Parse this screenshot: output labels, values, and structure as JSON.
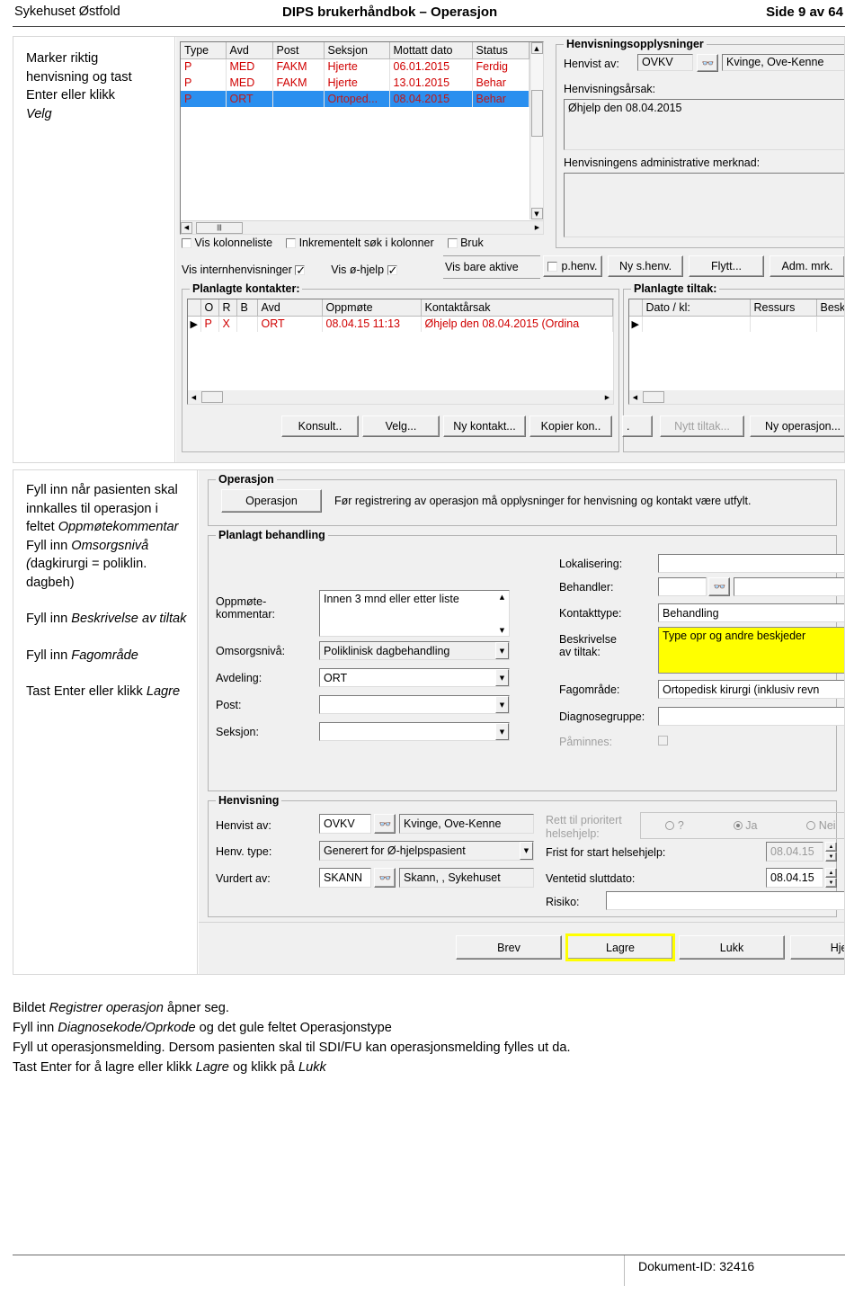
{
  "header": {
    "left": "Sykehuset Østfold",
    "center": "DIPS brukerhåndbok – Operasjon",
    "right": "Side 9 av 64"
  },
  "footer": {
    "document_id": "Dokument-ID: 32416"
  },
  "figure1": {
    "instructions": {
      "line1": "Marker riktig",
      "line2": "henvisning og tast",
      "line3": "Enter eller klikk",
      "line4_italic": "Velg"
    },
    "referral_list": {
      "columns": [
        "Type",
        "Avd",
        "Post",
        "Seksjon",
        "Mottatt dato",
        "Status"
      ],
      "rows": [
        {
          "type": "P",
          "avd": "MED",
          "post": "FAKM",
          "seksjon": "Hjerte",
          "mottatt": "06.01.2015",
          "status": "Ferdig",
          "selected": false
        },
        {
          "type": "P",
          "avd": "MED",
          "post": "FAKM",
          "seksjon": "Hjerte",
          "mottatt": "13.01.2015",
          "status": "Behar",
          "selected": false
        },
        {
          "type": "P",
          "avd": "ORT",
          "post": "",
          "seksjon": "Ortoped...",
          "mottatt": "08.04.2015",
          "status": "Behar",
          "selected": true
        }
      ]
    },
    "list_options": [
      {
        "label": "Vis kolonneliste",
        "checked": false
      },
      {
        "label": "Inkrementelt søk i kolonner",
        "checked": false
      },
      {
        "label": "Bruk",
        "checked": false
      }
    ],
    "filter_row": [
      {
        "label": "Vis internhenvisninger",
        "checked": true
      },
      {
        "label": "Vis ø-hjelp",
        "checked": true
      },
      {
        "label": "Vis bare aktive",
        "checked": false,
        "no_box": true
      },
      {
        "label": "p.henv.",
        "checked": false
      }
    ],
    "referral_buttons": [
      "Ny s.henv.",
      "Flytt...",
      "Adm. mrk."
    ],
    "referral_info": {
      "title": "Henvisningsopplysninger",
      "referred_by_label": "Henvist av:",
      "referred_by_code": "OVKV",
      "referred_by_name": "Kvinge, Ove-Kenne",
      "reason_label": "Henvisningsårsak:",
      "reason_value": "Øhjelp den 08.04.2015",
      "admin_note_label": "Henvisningens administrative merknad:",
      "admin_note_value": ""
    },
    "planned_contacts": {
      "title": "Planlagte kontakter:",
      "columns": [
        "",
        "O",
        "R",
        "B",
        "Avd",
        "Oppmøte",
        "Kontaktårsak"
      ],
      "rows": [
        {
          "o": "P",
          "r": "X",
          "b": "",
          "avd": "ORT",
          "oppmote": "08.04.15 11:13",
          "arsak": "Øhjelp den 08.04.2015 (Ordina"
        }
      ],
      "buttons": [
        "Konsult..",
        "Velg...",
        "Ny kontakt...",
        "Kopier kon.."
      ]
    },
    "planned_measures": {
      "title": "Planlagte tiltak:",
      "columns": [
        "",
        "Dato / kl:",
        "Ressurs",
        "Beskriv"
      ],
      "rows": [
        {
          "dato": "",
          "ressurs": "",
          "beskrivelse": ""
        }
      ],
      "buttons": [
        {
          "label": ".",
          "disabled": false
        },
        {
          "label": "Nytt tiltak...",
          "disabled": true
        },
        {
          "label": "Ny operasjon...",
          "disabled": false
        }
      ]
    }
  },
  "figure2": {
    "instructions": {
      "p1_a": "Fyll inn når pasienten skal innkalles til operasjon i feltet ",
      "p1_b_italic": "Oppmøtekommentar",
      "p2_a": "Fyll inn ",
      "p2_b_italic": "Omsorgsnivå (",
      "p2_c": "dagkirurgi = poliklin. dagbeh)",
      "p3_a": "Fyll inn ",
      "p3_b_italic": "Beskrivelse av tiltak",
      "p4_a": "Fyll inn ",
      "p4_b_italic": "Fagområde",
      "p5_a": "Tast Enter eller klikk ",
      "p5_b_italic": "Lagre"
    },
    "operation_group": {
      "title": "Operasjon",
      "button": "Operasjon",
      "note": "Før registrering av operasjon må opplysninger for henvisning og kontakt være utfylt."
    },
    "planned_treatment": {
      "title": "Planlagt behandling",
      "fields_left": [
        {
          "label": "Oppmøte-\nkommentar:",
          "value": "Innen 3 mnd eller etter liste",
          "type": "textarea"
        },
        {
          "label": "Omsorgsnivå:",
          "value": "Poliklinisk dagbehandling",
          "type": "combo"
        },
        {
          "label": "Avdeling:",
          "value": "ORT",
          "type": "combo"
        },
        {
          "label": "Post:",
          "value": "",
          "type": "combo"
        },
        {
          "label": "Seksjon:",
          "value": "",
          "type": "combo"
        }
      ],
      "fields_right": [
        {
          "label": "Lokalisering:",
          "value": "",
          "type": "combo"
        },
        {
          "label": "Behandler:",
          "value": "",
          "value2": "",
          "type": "lookup"
        },
        {
          "label": "Kontakttype:",
          "value": "Behandling",
          "type": "combo"
        },
        {
          "label": "Beskrivelse\nav tiltak:",
          "value": "Type opr og andre beskjeder",
          "type": "textarea",
          "highlight": "#ffff00"
        },
        {
          "label": "Fagområde:",
          "value": "Ortopedisk kirurgi (inklusiv revn",
          "type": "combo"
        },
        {
          "label": "Diagnosegruppe:",
          "value": "",
          "type": "combo"
        },
        {
          "label": "Påminnes:",
          "value": "",
          "type": "checkbox",
          "disabled": true
        }
      ]
    },
    "referral_group": {
      "title": "Henvisning",
      "referred_by_label": "Henvist av:",
      "referred_by_code": "OVKV",
      "referred_by_name": "Kvinge, Ove-Kenne",
      "type_label": "Henv. type:",
      "type_value": "Generert for Ø-hjelpspasient",
      "assessed_label": "Vurdert av:",
      "assessed_code": "SKANN",
      "assessed_name": "Skann, , Sykehuset"
    },
    "priority_group": {
      "right_label": "Rett til prioritert helsehjelp:",
      "options": [
        {
          "label": "?",
          "selected": false
        },
        {
          "label": "Ja",
          "selected": true
        },
        {
          "label": "Nei",
          "selected": false
        }
      ],
      "deadline_label": "Frist for start helsehjelp:",
      "deadline_value": "08.04.15",
      "waiting_end_label": "Ventetid sluttdato:",
      "waiting_end_value": "08.04.15",
      "risk_label": "Risiko:",
      "risk_value": ""
    },
    "dialog_buttons": [
      {
        "label": "Brev",
        "highlight": false
      },
      {
        "label": "Lagre",
        "highlight": true
      },
      {
        "label": "Lukk",
        "highlight": false
      },
      {
        "label": "Hjelp",
        "highlight": false
      }
    ],
    "highlight_color": "#ffff00"
  },
  "body_text": {
    "line1_a": "Bildet ",
    "line1_b_italic": "Registrer operasjon",
    "line1_c": " åpner seg.",
    "line2_a": "Fyll inn ",
    "line2_b_italic": "Diagnosekode/Oprkode",
    "line2_c": " og det gule feltet Operasjonstype",
    "line3": "Fyll ut operasjonsmelding. Dersom pasienten skal til SDI/FU kan operasjonsmelding fylles ut da.",
    "line4_a": "Tast Enter for å lagre eller klikk ",
    "line4_b_italic": "Lagre",
    "line4_c": " og klikk på ",
    "line4_d_italic": "Lukk"
  }
}
